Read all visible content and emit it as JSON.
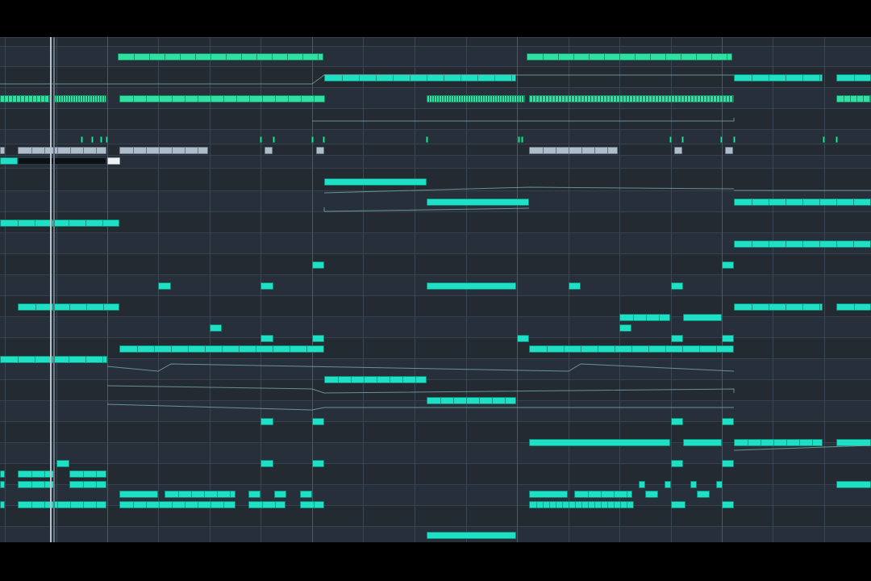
{
  "app": "piano-roll-editor",
  "colors": {
    "background": "#232a32",
    "lane_alt": "#27303a",
    "grid_line": "#3a4753",
    "note_teal": "#1fe0c4",
    "note_green": "#2fe0a0",
    "note_grey": "#aebccb",
    "note_white": "#eef2f5",
    "automation_line": "#7fb3b0",
    "playhead": "#b9c3cb"
  },
  "icons": []
}
